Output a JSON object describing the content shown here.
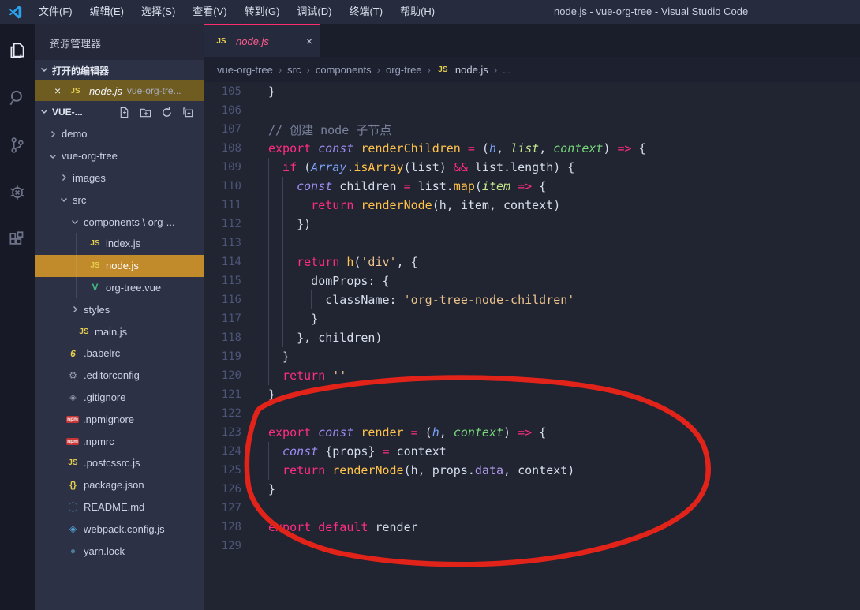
{
  "title_bar": {
    "title": "node.js - vue-org-tree - Visual Studio Code",
    "menus": [
      "文件(F)",
      "编辑(E)",
      "选择(S)",
      "查看(V)",
      "转到(G)",
      "调试(D)",
      "终端(T)",
      "帮助(H)"
    ]
  },
  "activity_bar": {
    "icons": [
      "explorer",
      "search",
      "source-control",
      "debug",
      "extensions"
    ],
    "active": "explorer"
  },
  "sidebar": {
    "panel_title": "资源管理器",
    "open_editors": {
      "header": "打开的编辑器",
      "item": {
        "close": "×",
        "icon": "js",
        "label": "node.js",
        "detail": "vue-org-tre..."
      }
    },
    "project": {
      "header": "VUE-...",
      "actions": [
        "new-file",
        "new-folder",
        "refresh",
        "collapse-all"
      ]
    },
    "tree": [
      {
        "label": "demo",
        "type": "folder",
        "state": "collapsed",
        "level": 0
      },
      {
        "label": "vue-org-tree",
        "type": "folder",
        "state": "expanded",
        "level": 0
      },
      {
        "label": "images",
        "type": "folder",
        "state": "collapsed",
        "level": 1
      },
      {
        "label": "src",
        "type": "folder",
        "state": "expanded",
        "level": 1
      },
      {
        "label": "components \\ org-...",
        "type": "folder",
        "state": "expanded",
        "level": 2
      },
      {
        "label": "index.js",
        "icon": "js",
        "level": 3
      },
      {
        "label": "node.js",
        "icon": "js",
        "level": 3,
        "selected": true
      },
      {
        "label": "org-tree.vue",
        "icon": "vue",
        "level": 3
      },
      {
        "label": "styles",
        "type": "folder",
        "state": "collapsed",
        "level": 2
      },
      {
        "label": "main.js",
        "icon": "js",
        "level": 2
      },
      {
        "label": ".babelrc",
        "icon": "babel",
        "level": 1
      },
      {
        "label": ".editorconfig",
        "icon": "gear",
        "level": 1
      },
      {
        "label": ".gitignore",
        "icon": "git",
        "level": 1
      },
      {
        "label": ".npmignore",
        "icon": "npm",
        "level": 1
      },
      {
        "label": ".npmrc",
        "icon": "npm",
        "level": 1
      },
      {
        "label": ".postcssrc.js",
        "icon": "js",
        "level": 1
      },
      {
        "label": "package.json",
        "icon": "json",
        "level": 1
      },
      {
        "label": "README.md",
        "icon": "info",
        "level": 1
      },
      {
        "label": "webpack.config.js",
        "icon": "webpack",
        "level": 1
      },
      {
        "label": "yarn.lock",
        "icon": "yarn",
        "level": 1
      }
    ]
  },
  "icons": {
    "js": "JS",
    "vue": "V",
    "babel": "6",
    "gear": "⚙",
    "git": "◈",
    "npm": "npm",
    "json": "{}",
    "info": "ⓘ",
    "webpack": "◈",
    "yarn": "●"
  },
  "editor": {
    "tab": {
      "icon": "js",
      "label": "node.js",
      "close": "×"
    },
    "breadcrumbs": [
      {
        "label": "vue-org-tree"
      },
      {
        "label": "src"
      },
      {
        "label": "components"
      },
      {
        "label": "org-tree"
      },
      {
        "label": "node.js",
        "icon": "js"
      },
      {
        "label": "..."
      }
    ],
    "code": [
      {
        "n": 105,
        "i": 0,
        "t": [
          [
            "}",
            "p"
          ]
        ]
      },
      {
        "n": 106,
        "i": 0,
        "t": []
      },
      {
        "n": 107,
        "i": 0,
        "t": [
          [
            "// 创建 node 子节点",
            "cm"
          ]
        ]
      },
      {
        "n": 108,
        "i": 0,
        "t": [
          [
            "export",
            "kw"
          ],
          [
            " ",
            "p"
          ],
          [
            "const",
            "cst"
          ],
          [
            " ",
            "p"
          ],
          [
            "renderChildren",
            "fn"
          ],
          [
            " ",
            "p"
          ],
          [
            "=",
            "kw"
          ],
          [
            " (",
            "p"
          ],
          [
            "h",
            "pb"
          ],
          [
            ", ",
            "p"
          ],
          [
            "list",
            "pl"
          ],
          [
            ", ",
            "p"
          ],
          [
            "context",
            "pg"
          ],
          [
            ") ",
            "p"
          ],
          [
            "=>",
            "kw"
          ],
          [
            " {",
            "p"
          ]
        ]
      },
      {
        "n": 109,
        "i": 2,
        "t": [
          [
            "if",
            "kw"
          ],
          [
            " (",
            "p"
          ],
          [
            "Array",
            "pb"
          ],
          [
            ".",
            "p"
          ],
          [
            "isArray",
            "fn"
          ],
          [
            "(",
            "p"
          ],
          [
            "list",
            "p"
          ],
          [
            ") ",
            "p"
          ],
          [
            "&&",
            "kw"
          ],
          [
            " ",
            "p"
          ],
          [
            "list.length",
            "p"
          ],
          [
            ") {",
            "p"
          ]
        ]
      },
      {
        "n": 110,
        "i": 4,
        "t": [
          [
            "const",
            "cst"
          ],
          [
            " ",
            "p"
          ],
          [
            "children",
            "p"
          ],
          [
            " ",
            "p"
          ],
          [
            "=",
            "kw"
          ],
          [
            " ",
            "p"
          ],
          [
            "list.",
            "p"
          ],
          [
            "map",
            "fn"
          ],
          [
            "(",
            "p"
          ],
          [
            "item",
            "pl"
          ],
          [
            " ",
            "p"
          ],
          [
            "=>",
            "kw"
          ],
          [
            " {",
            "p"
          ]
        ]
      },
      {
        "n": 111,
        "i": 6,
        "t": [
          [
            "return",
            "kw"
          ],
          [
            " ",
            "p"
          ],
          [
            "renderNode",
            "fn"
          ],
          [
            "(h, item, context)",
            "p"
          ]
        ]
      },
      {
        "n": 112,
        "i": 4,
        "t": [
          [
            "})",
            "p"
          ]
        ]
      },
      {
        "n": 113,
        "i": 4,
        "t": []
      },
      {
        "n": 114,
        "i": 4,
        "t": [
          [
            "return",
            "kw"
          ],
          [
            " ",
            "p"
          ],
          [
            "h",
            "fn"
          ],
          [
            "(",
            "p"
          ],
          [
            "'div'",
            "str"
          ],
          [
            ", {",
            "p"
          ]
        ]
      },
      {
        "n": 115,
        "i": 6,
        "t": [
          [
            "domProps",
            "p"
          ],
          [
            ": {",
            "p"
          ]
        ]
      },
      {
        "n": 116,
        "i": 8,
        "t": [
          [
            "className",
            "p"
          ],
          [
            ": ",
            "p"
          ],
          [
            "'org-tree-node-children'",
            "str"
          ]
        ]
      },
      {
        "n": 117,
        "i": 6,
        "t": [
          [
            "}",
            "p"
          ]
        ]
      },
      {
        "n": 118,
        "i": 4,
        "t": [
          [
            "}, children)",
            "p"
          ]
        ]
      },
      {
        "n": 119,
        "i": 2,
        "t": [
          [
            "}",
            "p"
          ]
        ]
      },
      {
        "n": 120,
        "i": 2,
        "t": [
          [
            "return",
            "kw"
          ],
          [
            " ",
            "p"
          ],
          [
            "''",
            "str"
          ]
        ]
      },
      {
        "n": 121,
        "i": 0,
        "t": [
          [
            "}",
            "p"
          ]
        ]
      },
      {
        "n": 122,
        "i": 0,
        "t": []
      },
      {
        "n": 123,
        "i": 0,
        "t": [
          [
            "export",
            "kw"
          ],
          [
            " ",
            "p"
          ],
          [
            "const",
            "cst"
          ],
          [
            " ",
            "p"
          ],
          [
            "render",
            "fn"
          ],
          [
            " ",
            "p"
          ],
          [
            "=",
            "kw"
          ],
          [
            " (",
            "p"
          ],
          [
            "h",
            "pb"
          ],
          [
            ", ",
            "p"
          ],
          [
            "context",
            "pg"
          ],
          [
            ") ",
            "p"
          ],
          [
            "=>",
            "kw"
          ],
          [
            " {",
            "p"
          ]
        ]
      },
      {
        "n": 124,
        "i": 2,
        "t": [
          [
            "const",
            "cst"
          ],
          [
            " {props} ",
            "p"
          ],
          [
            "=",
            "kw"
          ],
          [
            " context",
            "p"
          ]
        ]
      },
      {
        "n": 125,
        "i": 2,
        "t": [
          [
            "return",
            "kw"
          ],
          [
            " ",
            "p"
          ],
          [
            "renderNode",
            "fn"
          ],
          [
            "(h, props.",
            "p"
          ],
          [
            "data",
            "prop"
          ],
          [
            ", context)",
            "p"
          ]
        ]
      },
      {
        "n": 126,
        "i": 0,
        "t": [
          [
            "}",
            "p"
          ]
        ]
      },
      {
        "n": 127,
        "i": 0,
        "t": []
      },
      {
        "n": 128,
        "i": 0,
        "t": [
          [
            "export",
            "kw"
          ],
          [
            " ",
            "p"
          ],
          [
            "default",
            "kw"
          ],
          [
            " ",
            "p"
          ],
          [
            "render",
            "p"
          ]
        ]
      },
      {
        "n": 129,
        "i": 0,
        "t": []
      }
    ]
  },
  "annotation": {
    "shape": "hand-drawn-circle",
    "color": "#e2231a",
    "around_lines": "122-129"
  },
  "colors": {
    "selected_file_bg": "#c18a2b",
    "open_editor_bg": "#6e5c21",
    "tab_accent": "#ff2c6d",
    "keyword": "#ff2d83",
    "function": "#ffc24b",
    "string": "#ecc48d",
    "js_badge": "#e7cf4e"
  }
}
